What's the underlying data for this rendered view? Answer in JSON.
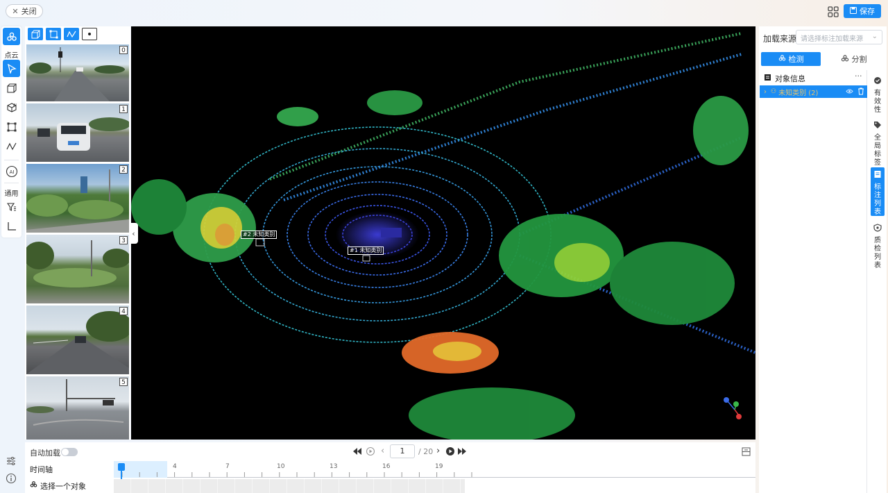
{
  "header": {
    "close_label": "关闭",
    "save_label": "保存"
  },
  "left_toolbar": {
    "section_pointcloud": "点云",
    "ai_label": "AI",
    "section_general": "通用"
  },
  "cameras": [
    {
      "index": "0"
    },
    {
      "index": "1"
    },
    {
      "index": "2"
    },
    {
      "index": "3"
    },
    {
      "index": "4"
    },
    {
      "index": "5"
    }
  ],
  "viewer": {
    "labels": [
      "#2 未知类别",
      "#1 未知类别"
    ],
    "axis_icon": "xyz-axis-gizmo"
  },
  "right_panel": {
    "source_label": "加载来源",
    "source_placeholder": "请选择标注加载来源",
    "tab_detect": "检测",
    "tab_segment": "分割",
    "object_info_title": "对象信息",
    "object_row": "未知类别 (2)",
    "side_tabs": [
      "有效性",
      "全局标签",
      "标注列表",
      "质检列表"
    ],
    "active_side_tab": "标注列表"
  },
  "bottom": {
    "autoload_label": "自动加载",
    "autoload_on": false,
    "frame_current": "1",
    "frame_total": "/ 20",
    "timeline_label": "时间轴",
    "select_object_label": "选择一个对象",
    "ticks": [
      "4",
      "7",
      "10",
      "13",
      "16",
      "19"
    ]
  },
  "colors": {
    "accent": "#1a8cf5",
    "category_label": "#e9c46a"
  }
}
